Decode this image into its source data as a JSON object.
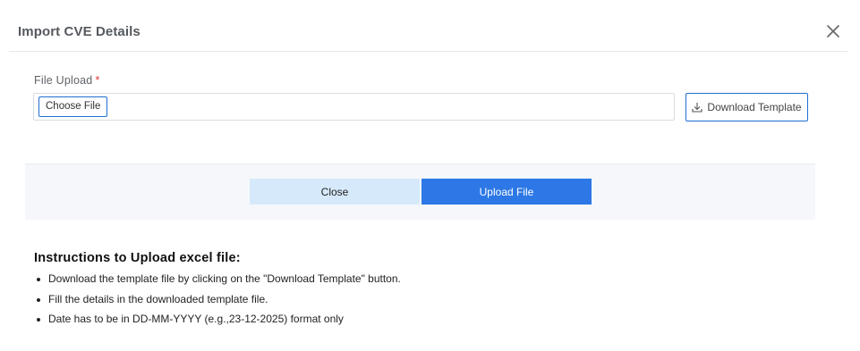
{
  "dialog": {
    "title": "Import CVE Details",
    "close_icon": "close-icon"
  },
  "file_upload": {
    "label": "File Upload",
    "required_marker": "*",
    "choose_file_label": "Choose File",
    "download_template_label": "Download Template",
    "download_icon": "download-icon"
  },
  "actions": {
    "close_label": "Close",
    "upload_label": "Upload File"
  },
  "instructions": {
    "title": "Instructions to Upload excel file:",
    "items": [
      "Download the template file by clicking on the \"Download Template\" button.",
      "Fill the details in the downloaded template file.",
      "Date has to be in DD-MM-YYYY (e.g.,23-12-2025) format only"
    ]
  },
  "colors": {
    "primary": "#2d78e6",
    "secondary_button": "#d6e9fa",
    "required": "#e53935",
    "footer_background": "#f5f7fa"
  }
}
